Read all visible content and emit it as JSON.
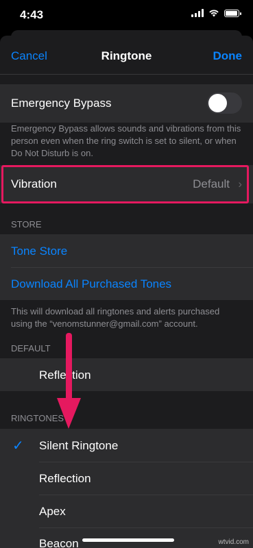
{
  "status": {
    "time": "4:43"
  },
  "nav": {
    "cancel": "Cancel",
    "title": "Ringtone",
    "done": "Done"
  },
  "emergency": {
    "label": "Emergency Bypass",
    "footer": "Emergency Bypass allows sounds and vibrations from this person even when the ring switch is set to silent, or when Do Not Disturb is on."
  },
  "vibration": {
    "label": "Vibration",
    "value": "Default"
  },
  "store": {
    "header": "STORE",
    "tone_store": "Tone Store",
    "download_all": "Download All Purchased Tones",
    "footer": "This will download all ringtones and alerts purchased using the “venomstunner@gmail.com” account."
  },
  "default_section": {
    "header": "DEFAULT",
    "item": "Reflection"
  },
  "ringtones": {
    "header": "RINGTONES",
    "items": [
      "Silent Ringtone",
      "Reflection",
      "Apex",
      "Beacon"
    ],
    "selected": "Silent Ringtone"
  },
  "colors": {
    "accent": "#0a84ff",
    "highlight": "#e5195f"
  },
  "watermark": "wtvid.com"
}
